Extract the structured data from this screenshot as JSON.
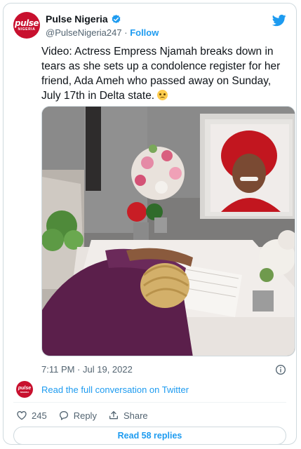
{
  "account": {
    "display_name": "Pulse Nigeria",
    "handle": "@PulseNigeria247",
    "separator": "·",
    "follow_label": "Follow",
    "avatar_logo_text": "pulse",
    "avatar_sub_text": "NIGERIA"
  },
  "tweet": {
    "text": "Video: Actress Empress Njamah breaks down in tears as she sets up a condolence register for her friend, Ada Ameh who passed away on Sunday, July 17th in Delta state.",
    "emoji": "crying-face-emoji",
    "timestamp": "7:11 PM · Jul 19, 2022"
  },
  "conversation": {
    "link_label": "Read the full conversation on Twitter"
  },
  "actions": {
    "likes_count": "245",
    "reply_label": "Reply",
    "share_label": "Share"
  },
  "replies_button": {
    "label": "Read 58 replies"
  },
  "colors": {
    "brand_red": "#c8102e",
    "link_blue": "#1d9bf0",
    "muted_text": "#536471",
    "border": "#cfd9de"
  }
}
